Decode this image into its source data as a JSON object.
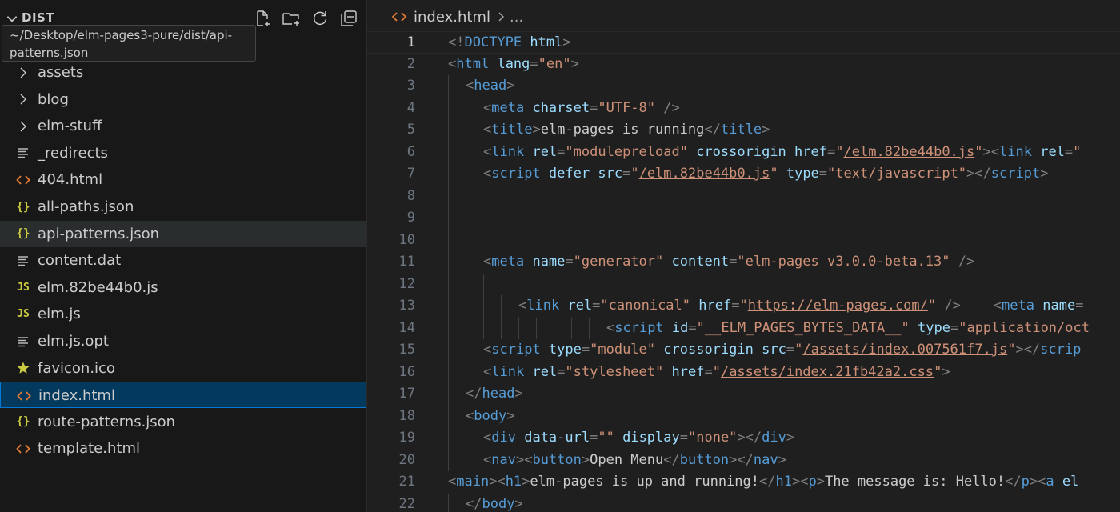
{
  "explorer": {
    "title": "DIST",
    "tooltip": "~/Desktop/elm-pages3-pure/dist/api-patterns.json",
    "items": [
      {
        "label": "assets",
        "type": "folder",
        "icon": "chevron-right-icon"
      },
      {
        "label": "blog",
        "type": "folder",
        "icon": "chevron-right-icon"
      },
      {
        "label": "elm-stuff",
        "type": "folder",
        "icon": "chevron-right-icon"
      },
      {
        "label": "_redirects",
        "type": "file",
        "icon": "text-file-icon"
      },
      {
        "label": "404.html",
        "type": "file",
        "icon": "html-file-icon"
      },
      {
        "label": "all-paths.json",
        "type": "file",
        "icon": "json-file-icon"
      },
      {
        "label": "api-patterns.json",
        "type": "file",
        "icon": "json-file-icon",
        "state": "hover"
      },
      {
        "label": "content.dat",
        "type": "file",
        "icon": "text-file-icon"
      },
      {
        "label": "elm.82be44b0.js",
        "type": "file",
        "icon": "js-file-icon"
      },
      {
        "label": "elm.js",
        "type": "file",
        "icon": "js-file-icon"
      },
      {
        "label": "elm.js.opt",
        "type": "file",
        "icon": "text-file-icon"
      },
      {
        "label": "favicon.ico",
        "type": "file",
        "icon": "star-icon"
      },
      {
        "label": "index.html",
        "type": "file",
        "icon": "html-file-icon",
        "state": "selected"
      },
      {
        "label": "route-patterns.json",
        "type": "file",
        "icon": "json-file-icon"
      },
      {
        "label": "template.html",
        "type": "file",
        "icon": "html-file-icon"
      }
    ]
  },
  "breadcrumb": {
    "file": "index.html",
    "more": "..."
  },
  "editor": {
    "current_line": 1,
    "lines": [
      {
        "n": "1",
        "indent": 0,
        "tokens": [
          [
            "p",
            "<!"
          ],
          [
            "tag",
            "DOCTYPE"
          ],
          [
            "p",
            " "
          ],
          [
            "attr",
            "html"
          ],
          [
            "p",
            ">"
          ]
        ]
      },
      {
        "n": "2",
        "indent": 0,
        "tokens": [
          [
            "p",
            "<"
          ],
          [
            "tag",
            "html"
          ],
          [
            "p",
            " "
          ],
          [
            "attr",
            "lang"
          ],
          [
            "p",
            "="
          ],
          [
            "str",
            "\"en\""
          ],
          [
            "p",
            ">"
          ]
        ]
      },
      {
        "n": "3",
        "indent": 1,
        "tokens": [
          [
            "p",
            "<"
          ],
          [
            "tag",
            "head"
          ],
          [
            "p",
            ">"
          ]
        ]
      },
      {
        "n": "4",
        "indent": 2,
        "tokens": [
          [
            "p",
            "<"
          ],
          [
            "tag",
            "meta"
          ],
          [
            "p",
            " "
          ],
          [
            "attr",
            "charset"
          ],
          [
            "p",
            "="
          ],
          [
            "str",
            "\"UTF-8\""
          ],
          [
            "p",
            " />"
          ]
        ]
      },
      {
        "n": "5",
        "indent": 2,
        "tokens": [
          [
            "p",
            "<"
          ],
          [
            "tag",
            "title"
          ],
          [
            "p",
            ">"
          ],
          [
            "txt",
            "elm-pages is running"
          ],
          [
            "p",
            "</"
          ],
          [
            "tag",
            "title"
          ],
          [
            "p",
            ">"
          ]
        ]
      },
      {
        "n": "6",
        "indent": 2,
        "tokens": [
          [
            "p",
            "<"
          ],
          [
            "tag",
            "link"
          ],
          [
            "p",
            " "
          ],
          [
            "attr",
            "rel"
          ],
          [
            "p",
            "="
          ],
          [
            "str",
            "\"modulepreload\""
          ],
          [
            "p",
            " "
          ],
          [
            "attr",
            "crossorigin"
          ],
          [
            "p",
            " "
          ],
          [
            "attr",
            "href"
          ],
          [
            "p",
            "="
          ],
          [
            "str",
            "\""
          ],
          [
            "link",
            "/elm.82be44b0.js"
          ],
          [
            "str",
            "\""
          ],
          [
            "p",
            "><"
          ],
          [
            "tag",
            "link"
          ],
          [
            "p",
            " "
          ],
          [
            "attr",
            "rel"
          ],
          [
            "p",
            "="
          ],
          [
            "str",
            "\""
          ]
        ]
      },
      {
        "n": "7",
        "indent": 2,
        "tokens": [
          [
            "p",
            "<"
          ],
          [
            "tag",
            "script"
          ],
          [
            "p",
            " "
          ],
          [
            "attr",
            "defer"
          ],
          [
            "p",
            " "
          ],
          [
            "attr",
            "src"
          ],
          [
            "p",
            "="
          ],
          [
            "str",
            "\""
          ],
          [
            "link",
            "/elm.82be44b0.js"
          ],
          [
            "str",
            "\""
          ],
          [
            "p",
            " "
          ],
          [
            "attr",
            "type"
          ],
          [
            "p",
            "="
          ],
          [
            "str",
            "\"text/javascript\""
          ],
          [
            "p",
            "></"
          ],
          [
            "tag",
            "script"
          ],
          [
            "p",
            ">"
          ]
        ]
      },
      {
        "n": "8",
        "indent": 2,
        "tokens": []
      },
      {
        "n": "9",
        "indent": 2,
        "tokens": []
      },
      {
        "n": "10",
        "indent": 2,
        "tokens": []
      },
      {
        "n": "11",
        "indent": 2,
        "tokens": [
          [
            "p",
            "<"
          ],
          [
            "tag",
            "meta"
          ],
          [
            "p",
            " "
          ],
          [
            "attr",
            "name"
          ],
          [
            "p",
            "="
          ],
          [
            "str",
            "\"generator\""
          ],
          [
            "p",
            " "
          ],
          [
            "attr",
            "content"
          ],
          [
            "p",
            "="
          ],
          [
            "str",
            "\"elm-pages v3.0.0-beta.13\""
          ],
          [
            "p",
            " />"
          ]
        ]
      },
      {
        "n": "12",
        "indent": 3,
        "tokens": []
      },
      {
        "n": "13",
        "indent": 4,
        "tokens": [
          [
            "p",
            "<"
          ],
          [
            "tag",
            "link"
          ],
          [
            "p",
            " "
          ],
          [
            "attr",
            "rel"
          ],
          [
            "p",
            "="
          ],
          [
            "str",
            "\"canonical\""
          ],
          [
            "p",
            " "
          ],
          [
            "attr",
            "href"
          ],
          [
            "p",
            "="
          ],
          [
            "str",
            "\""
          ],
          [
            "link",
            "https://elm-pages.com/"
          ],
          [
            "str",
            "\""
          ],
          [
            "p",
            " />    <"
          ],
          [
            "tag",
            "meta"
          ],
          [
            "p",
            " "
          ],
          [
            "attr",
            "name"
          ],
          [
            "p",
            "="
          ]
        ]
      },
      {
        "n": "14",
        "indent": 9,
        "tokens": [
          [
            "p",
            "<"
          ],
          [
            "tag",
            "script"
          ],
          [
            "p",
            " "
          ],
          [
            "attr",
            "id"
          ],
          [
            "p",
            "="
          ],
          [
            "str",
            "\"__ELM_PAGES_BYTES_DATA__\""
          ],
          [
            "p",
            " "
          ],
          [
            "attr",
            "type"
          ],
          [
            "p",
            "="
          ],
          [
            "str",
            "\"application/oct"
          ]
        ]
      },
      {
        "n": "15",
        "indent": 2,
        "tokens": [
          [
            "p",
            "<"
          ],
          [
            "tag",
            "script"
          ],
          [
            "p",
            " "
          ],
          [
            "attr",
            "type"
          ],
          [
            "p",
            "="
          ],
          [
            "str",
            "\"module\""
          ],
          [
            "p",
            " "
          ],
          [
            "attr",
            "crossorigin"
          ],
          [
            "p",
            " "
          ],
          [
            "attr",
            "src"
          ],
          [
            "p",
            "="
          ],
          [
            "str",
            "\""
          ],
          [
            "link",
            "/assets/index.007561f7.js"
          ],
          [
            "str",
            "\""
          ],
          [
            "p",
            "></"
          ],
          [
            "tag",
            "scrip"
          ]
        ]
      },
      {
        "n": "16",
        "indent": 2,
        "tokens": [
          [
            "p",
            "<"
          ],
          [
            "tag",
            "link"
          ],
          [
            "p",
            " "
          ],
          [
            "attr",
            "rel"
          ],
          [
            "p",
            "="
          ],
          [
            "str",
            "\"stylesheet\""
          ],
          [
            "p",
            " "
          ],
          [
            "attr",
            "href"
          ],
          [
            "p",
            "="
          ],
          [
            "str",
            "\""
          ],
          [
            "link",
            "/assets/index.21fb42a2.css"
          ],
          [
            "str",
            "\""
          ],
          [
            "p",
            ">"
          ]
        ]
      },
      {
        "n": "17",
        "indent": 1,
        "tokens": [
          [
            "p",
            "</"
          ],
          [
            "tag",
            "head"
          ],
          [
            "p",
            ">"
          ]
        ]
      },
      {
        "n": "18",
        "indent": 1,
        "tokens": [
          [
            "p",
            "<"
          ],
          [
            "tag",
            "body"
          ],
          [
            "p",
            ">"
          ]
        ]
      },
      {
        "n": "19",
        "indent": 2,
        "tokens": [
          [
            "p",
            "<"
          ],
          [
            "tag",
            "div"
          ],
          [
            "p",
            " "
          ],
          [
            "attr",
            "data-url"
          ],
          [
            "p",
            "="
          ],
          [
            "str",
            "\"\""
          ],
          [
            "p",
            " "
          ],
          [
            "attr",
            "display"
          ],
          [
            "p",
            "="
          ],
          [
            "str",
            "\"none\""
          ],
          [
            "p",
            "></"
          ],
          [
            "tag",
            "div"
          ],
          [
            "p",
            ">"
          ]
        ]
      },
      {
        "n": "20",
        "indent": 2,
        "tokens": [
          [
            "p",
            "<"
          ],
          [
            "tag",
            "nav"
          ],
          [
            "p",
            "><"
          ],
          [
            "tag",
            "button"
          ],
          [
            "p",
            ">"
          ],
          [
            "txt",
            "Open Menu"
          ],
          [
            "p",
            "</"
          ],
          [
            "tag",
            "button"
          ],
          [
            "p",
            "></"
          ],
          [
            "tag",
            "nav"
          ],
          [
            "p",
            ">"
          ]
        ]
      },
      {
        "n": "21",
        "indent": 0,
        "tokens": [
          [
            "p",
            "<"
          ],
          [
            "tag",
            "main"
          ],
          [
            "p",
            "><"
          ],
          [
            "tag",
            "h1"
          ],
          [
            "p",
            ">"
          ],
          [
            "txt",
            "elm-pages is up and running!"
          ],
          [
            "p",
            "</"
          ],
          [
            "tag",
            "h1"
          ],
          [
            "p",
            "><"
          ],
          [
            "tag",
            "p"
          ],
          [
            "p",
            ">"
          ],
          [
            "txt",
            "The message is: Hello!"
          ],
          [
            "p",
            "</"
          ],
          [
            "tag",
            "p"
          ],
          [
            "p",
            "><"
          ],
          [
            "tag",
            "a"
          ],
          [
            "p",
            " "
          ],
          [
            "attr",
            "el"
          ]
        ]
      },
      {
        "n": "22",
        "indent": 1,
        "tokens": [
          [
            "p",
            "</"
          ],
          [
            "tag",
            "body"
          ],
          [
            "p",
            ">"
          ]
        ]
      }
    ]
  }
}
